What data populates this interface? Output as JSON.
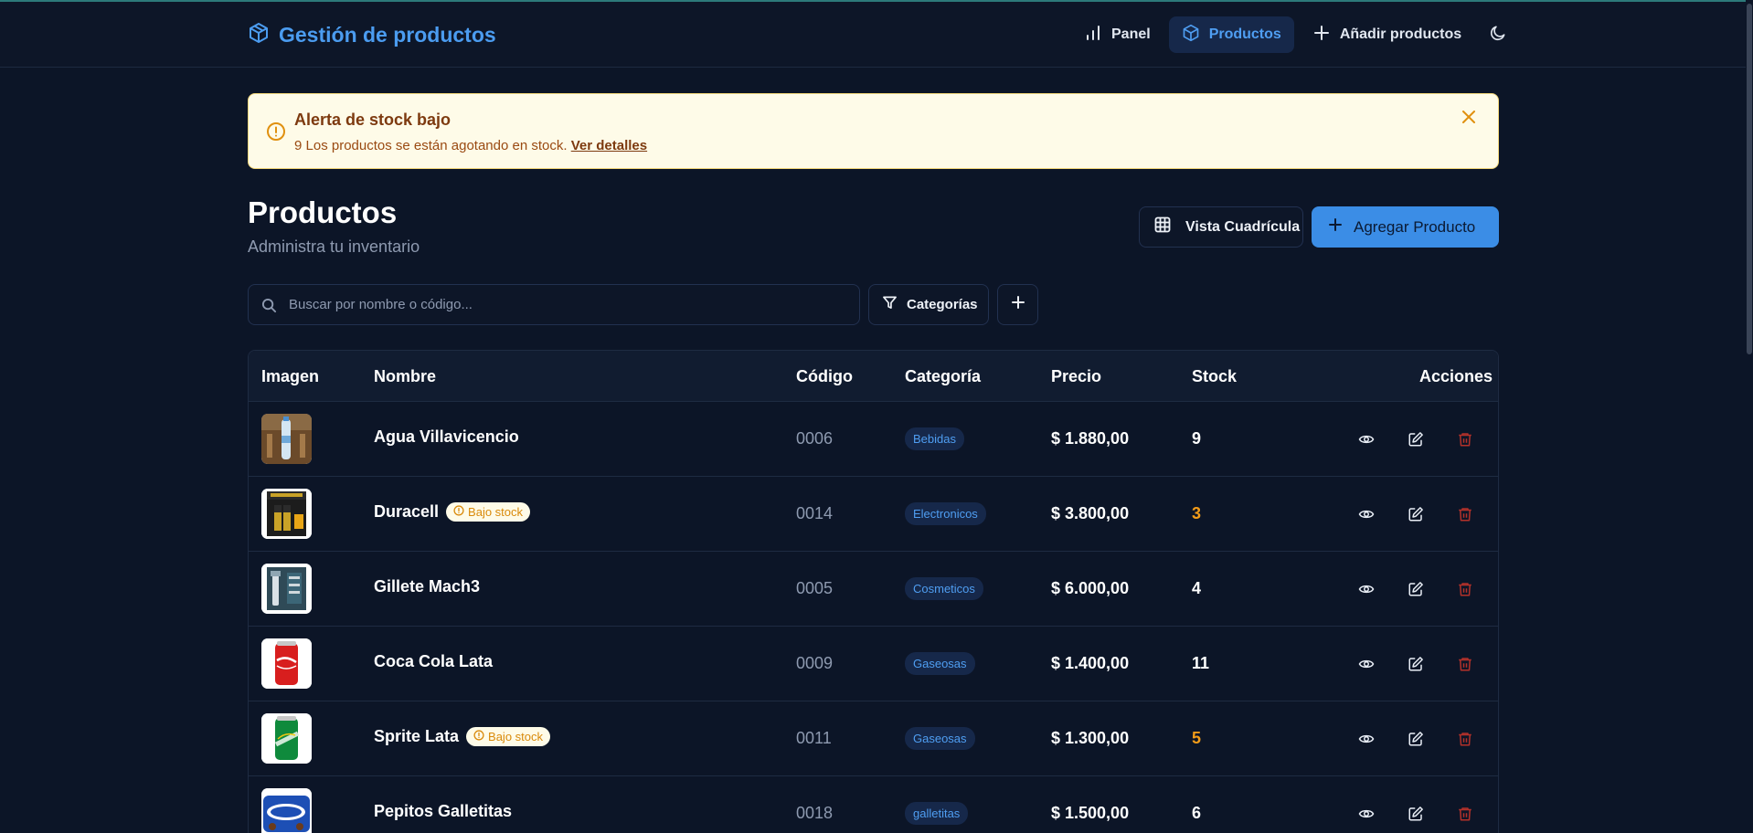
{
  "navbar": {
    "brand": "Gestión de productos",
    "links": [
      {
        "label": "Panel",
        "icon": "bar-chart-icon"
      },
      {
        "label": "Productos",
        "icon": "package-icon",
        "active": true
      },
      {
        "label": "Añadir productos",
        "icon": "plus-icon"
      }
    ],
    "theme_icon": "moon-icon"
  },
  "alert": {
    "title": "Alerta de stock bajo",
    "message": "9 Los productos se están agotando en stock.",
    "link": "Ver detalles"
  },
  "header": {
    "title": "Productos",
    "subtitle": "Administra tu inventario",
    "grid_view_label": "Vista Cuadrícula",
    "add_product_label": "Agregar Producto"
  },
  "filters": {
    "search_placeholder": "Buscar por nombre o código...",
    "categories_label": "Categorías"
  },
  "table": {
    "headers": {
      "image": "Imagen",
      "name": "Nombre",
      "code": "Código",
      "category": "Categoría",
      "price": "Precio",
      "stock": "Stock",
      "actions": "Acciones"
    },
    "low_stock_badge": "Bajo stock",
    "rows": [
      {
        "name": "Agua Villavicencio",
        "code": "0006",
        "category": "Bebidas",
        "price": "$ 1.880,00",
        "stock": "9",
        "low": false
      },
      {
        "name": "Duracell",
        "code": "0014",
        "category": "Electronicos",
        "price": "$ 3.800,00",
        "stock": "3",
        "low": true
      },
      {
        "name": "Gillete Mach3",
        "code": "0005",
        "category": "Cosmeticos",
        "price": "$ 6.000,00",
        "stock": "4",
        "low": false
      },
      {
        "name": "Coca Cola Lata",
        "code": "0009",
        "category": "Gaseosas",
        "price": "$ 1.400,00",
        "stock": "11",
        "low": false
      },
      {
        "name": "Sprite Lata",
        "code": "0011",
        "category": "Gaseosas",
        "price": "$ 1.300,00",
        "stock": "5",
        "low": true
      },
      {
        "name": "Pepitos Galletitas",
        "code": "0018",
        "category": "galletitas",
        "price": "$ 1.500,00",
        "stock": "6",
        "low": false
      }
    ]
  },
  "colors": {
    "background": "#0c1527",
    "accent": "#3b8de6",
    "warning": "#f39c19",
    "danger": "#c0392b"
  }
}
